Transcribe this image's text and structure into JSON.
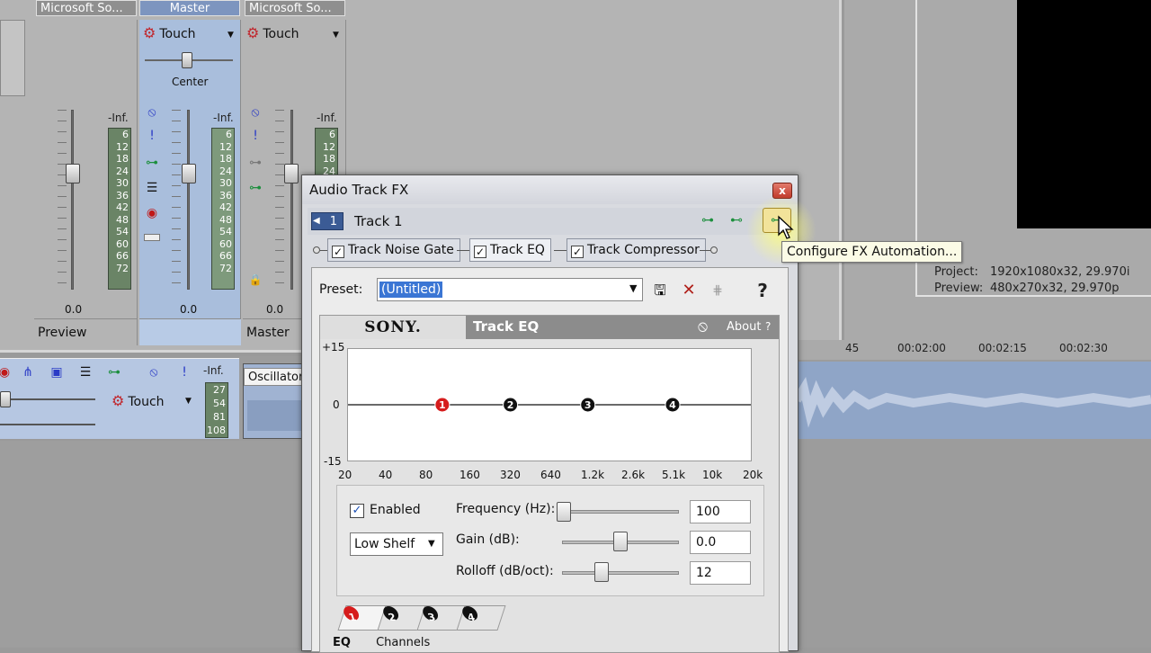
{
  "mixer": {
    "strips": [
      {
        "name": "Microsoft So...",
        "footer": "Preview",
        "value": "0.0"
      },
      {
        "name": "Master",
        "footer": "",
        "value": "0.0"
      },
      {
        "name": "Microsoft So...",
        "footer": "Master",
        "value": "0.0"
      }
    ],
    "touch_label": "Touch",
    "pan_label": "Center",
    "inf_label": "-Inf.",
    "meter_scale": [
      "6",
      "12",
      "18",
      "24",
      "30",
      "36",
      "42",
      "48",
      "54",
      "60",
      "66",
      "72"
    ]
  },
  "timeline": {
    "track_touch": "Touch",
    "track_inf": "-Inf.",
    "track_meter": [
      "27",
      "54",
      "81",
      "108"
    ],
    "clip_title": "Oscillator",
    "ruler": [
      "45",
      "00:02:00",
      "00:02:15",
      "00:02:30"
    ]
  },
  "preview_info": {
    "project_label": "Project:",
    "project_value": "1920x1080x32, 29.970i",
    "preview_label": "Preview:",
    "preview_value": "480x270x32, 29.970p"
  },
  "fx_dialog": {
    "title": "Audio Track FX",
    "close_label": "x",
    "track_number": "1",
    "track_name": "Track 1",
    "plugins": [
      {
        "label": "Track Noise Gate",
        "checked": "✓"
      },
      {
        "label": "Track EQ",
        "checked": "✓"
      },
      {
        "label": "Track Compressor",
        "checked": "✓"
      }
    ],
    "tooltip": "Configure FX Automation...",
    "preset_label": "Preset:",
    "preset_value": "(Untitled)",
    "vendor": "SONY.",
    "plugin_title": "Track EQ",
    "about_label": "About",
    "about_help": "?",
    "help_label": "?"
  },
  "eq": {
    "y_ticks": [
      "+15",
      "0",
      "-15"
    ],
    "x_ticks": [
      "20",
      "40",
      "80",
      "160",
      "320",
      "640",
      "1.2k",
      "2.6k",
      "5.1k",
      "10k",
      "20k"
    ],
    "bands": [
      {
        "label": "1",
        "freq_hz": 100,
        "gain_db": 0
      },
      {
        "label": "2",
        "freq_hz": 320,
        "gain_db": 0
      },
      {
        "label": "3",
        "freq_hz": 1200,
        "gain_db": 0
      },
      {
        "label": "4",
        "freq_hz": 5100,
        "gain_db": 0
      }
    ],
    "enabled_label": "Enabled",
    "enabled_check": "✓",
    "shape": "Low Shelf",
    "frequency_label": "Frequency (Hz):",
    "frequency_value": "100",
    "gain_label": "Gain (dB):",
    "gain_value": "0.0",
    "rolloff_label": "Rolloff (dB/oct):",
    "rolloff_value": "12",
    "band_tabs": [
      "1",
      "2",
      "3",
      "4"
    ],
    "bottom_tabs": [
      "EQ",
      "Channels"
    ]
  },
  "colors": {
    "accent_blue": "#3b76d4",
    "band_active": "#d61c1c",
    "highlight_yellow": "#f2e39a"
  }
}
